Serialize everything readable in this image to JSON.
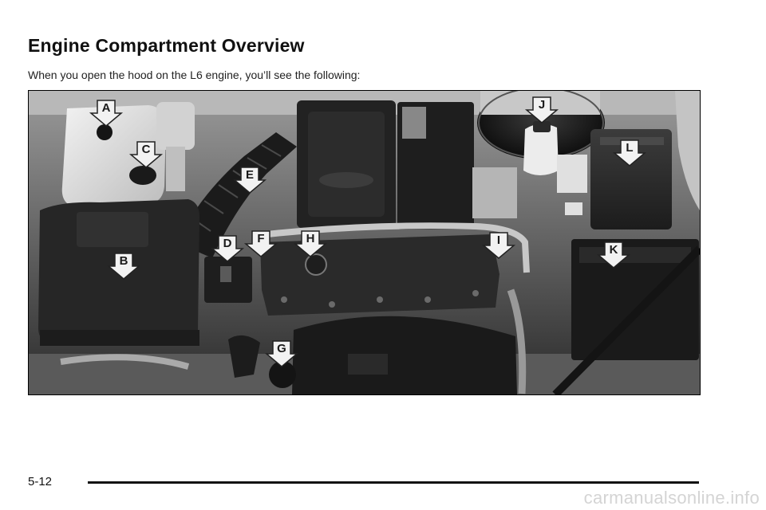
{
  "page": {
    "title": "Engine Compartment Overview",
    "intro": "When you open the hood on the L6 engine, you’ll see the following:",
    "page_number": "5-12",
    "watermark": "carmanualsonline.info"
  },
  "photo": {
    "callouts": [
      "A",
      "B",
      "C",
      "D",
      "E",
      "F",
      "G",
      "H",
      "I",
      "J",
      "K",
      "L"
    ]
  }
}
